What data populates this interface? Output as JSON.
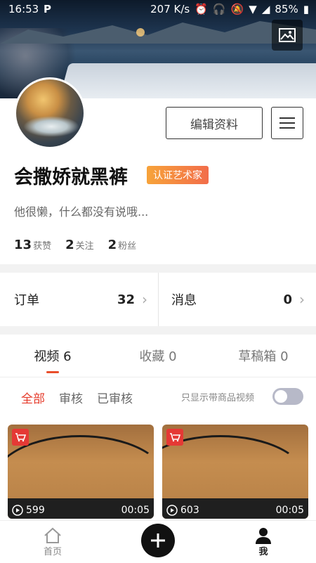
{
  "status_bar": {
    "time": "16:53",
    "speed": "207 K/s",
    "battery": "85%",
    "app_indicator": "P"
  },
  "profile": {
    "name": "会撒娇就黑裤",
    "badge": "认证艺术家",
    "bio": "他很懒，什么都没有说哦...",
    "edit_button": "编辑资料",
    "stats": [
      {
        "count": "13",
        "label": "获赞"
      },
      {
        "count": "2",
        "label": "关注"
      },
      {
        "count": "2",
        "label": "粉丝"
      }
    ]
  },
  "summary": {
    "orders": {
      "label": "订单",
      "value": "32"
    },
    "messages": {
      "label": "消息",
      "value": "0"
    }
  },
  "tabs": [
    {
      "label": "视频 6",
      "active": true
    },
    {
      "label": "收藏 0",
      "active": false
    },
    {
      "label": "草稿箱 0",
      "active": false
    }
  ],
  "filters": {
    "items": [
      "全部",
      "审核",
      "已审核"
    ],
    "only_goods_label": "只显示带商品视频"
  },
  "videos": [
    {
      "plays": "599",
      "duration": "00:05"
    },
    {
      "plays": "603",
      "duration": "00:05"
    }
  ],
  "bottom_nav": {
    "home": "首页",
    "me": "我"
  },
  "colors": {
    "accent": "#e94e2a",
    "badge_start": "#f7a33a",
    "badge_end": "#f26d4a"
  }
}
